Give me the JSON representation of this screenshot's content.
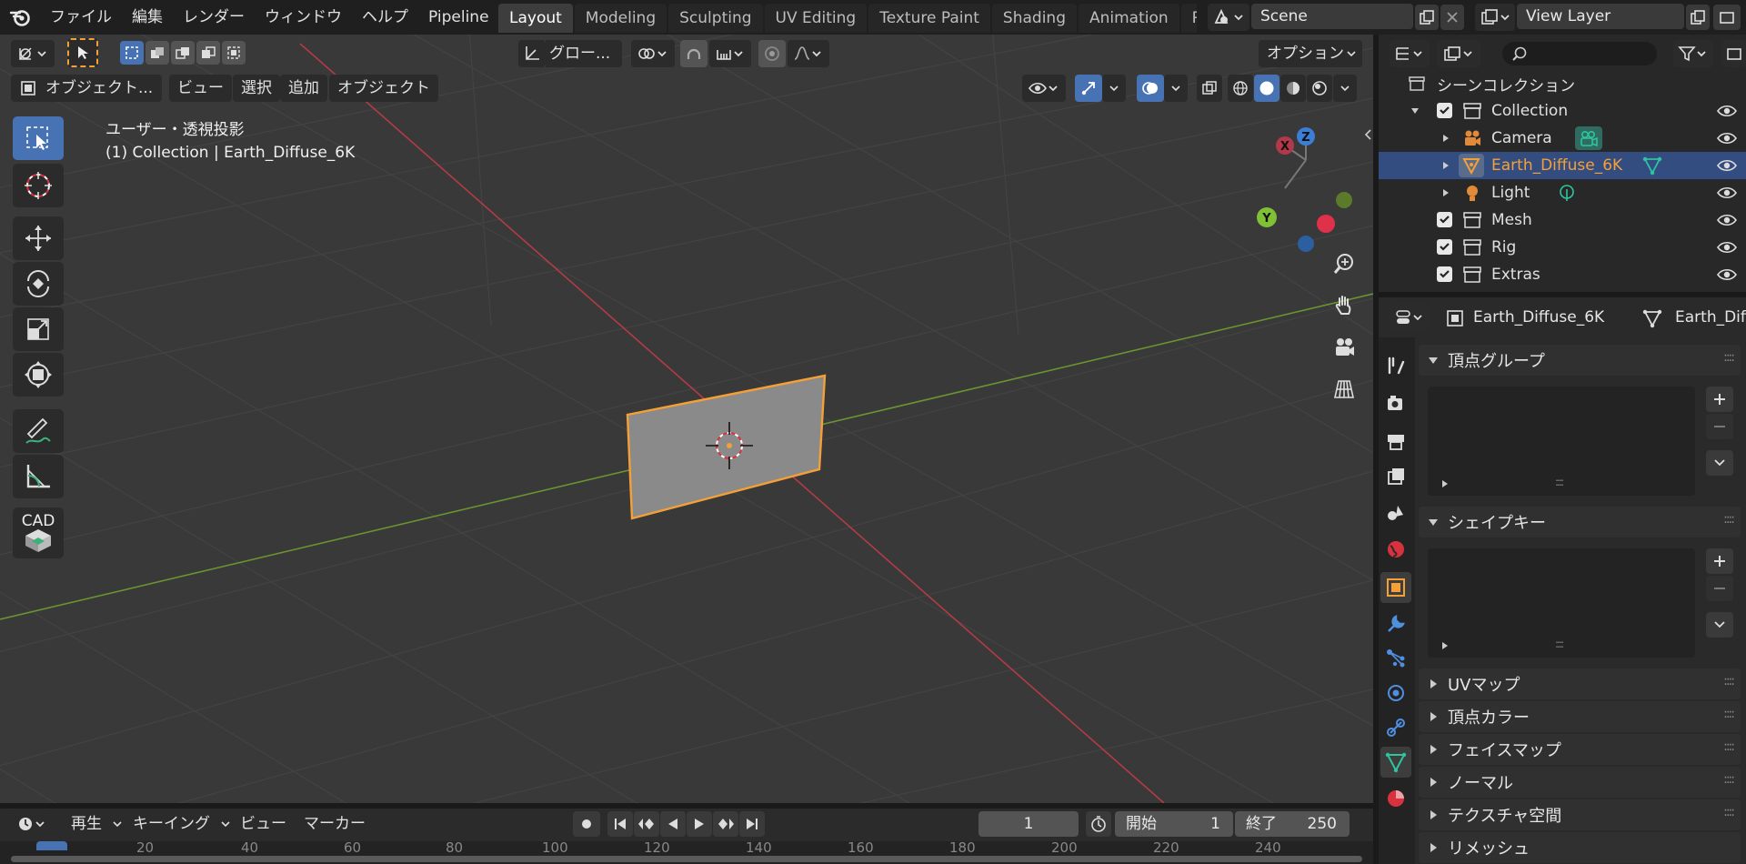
{
  "menu": {
    "items": [
      "ファイル",
      "編集",
      "レンダー",
      "ウィンドウ",
      "ヘルプ",
      "Pipeline"
    ]
  },
  "workspaces": [
    "Layout",
    "Modeling",
    "Sculpting",
    "UV Editing",
    "Texture Paint",
    "Shading",
    "Animation",
    "Re"
  ],
  "scene": {
    "name": "Scene"
  },
  "view_layer": {
    "name": "View Layer"
  },
  "viewport": {
    "header": {
      "orientation": "グロー...",
      "options": "オプション",
      "mode": "オブジェクト...",
      "menus": [
        "ビュー",
        "選択",
        "追加",
        "オブジェクト"
      ]
    },
    "overlay_title": "ユーザー・透視投影",
    "overlay_subtitle": "(1) Collection | Earth_Diffuse_6K",
    "gizmo": {
      "x": "X",
      "y": "Y",
      "z": "Z"
    }
  },
  "outliner": {
    "root": "シーンコレクション",
    "rows": [
      {
        "label": "Collection"
      },
      {
        "label": "Camera"
      },
      {
        "label": "Earth_Diffuse_6K"
      },
      {
        "label": "Light"
      },
      {
        "label": "Mesh"
      },
      {
        "label": "Rig"
      },
      {
        "label": "Extras"
      }
    ]
  },
  "properties": {
    "object_name": "Earth_Diffuse_6K",
    "data_name": "Earth_Diff",
    "panels": {
      "vertex_groups": "頂点グループ",
      "shape_keys": "シェイプキー",
      "collapsed": [
        "UVマップ",
        "頂点カラー",
        "フェイスマップ",
        "ノーマル",
        "テクスチャ空間",
        "リメッシュ"
      ]
    }
  },
  "timeline": {
    "menus": [
      "再生",
      "キーイング",
      "ビュー",
      "マーカー"
    ],
    "current_frame": "1",
    "start_label": "開始",
    "start_value": "1",
    "end_label": "終了",
    "end_value": "250",
    "ruler": [
      "20",
      "40",
      "60",
      "80",
      "100",
      "120",
      "140",
      "160",
      "180",
      "200",
      "220",
      "240"
    ]
  },
  "colors": {
    "accent_blue": "#4772b3",
    "selected_orange": "#f5a037",
    "x_axis": "#c7424f",
    "y_axis": "#77a133",
    "z_axis": "#3a7ed6",
    "data_teal": "#2ec4a0"
  }
}
